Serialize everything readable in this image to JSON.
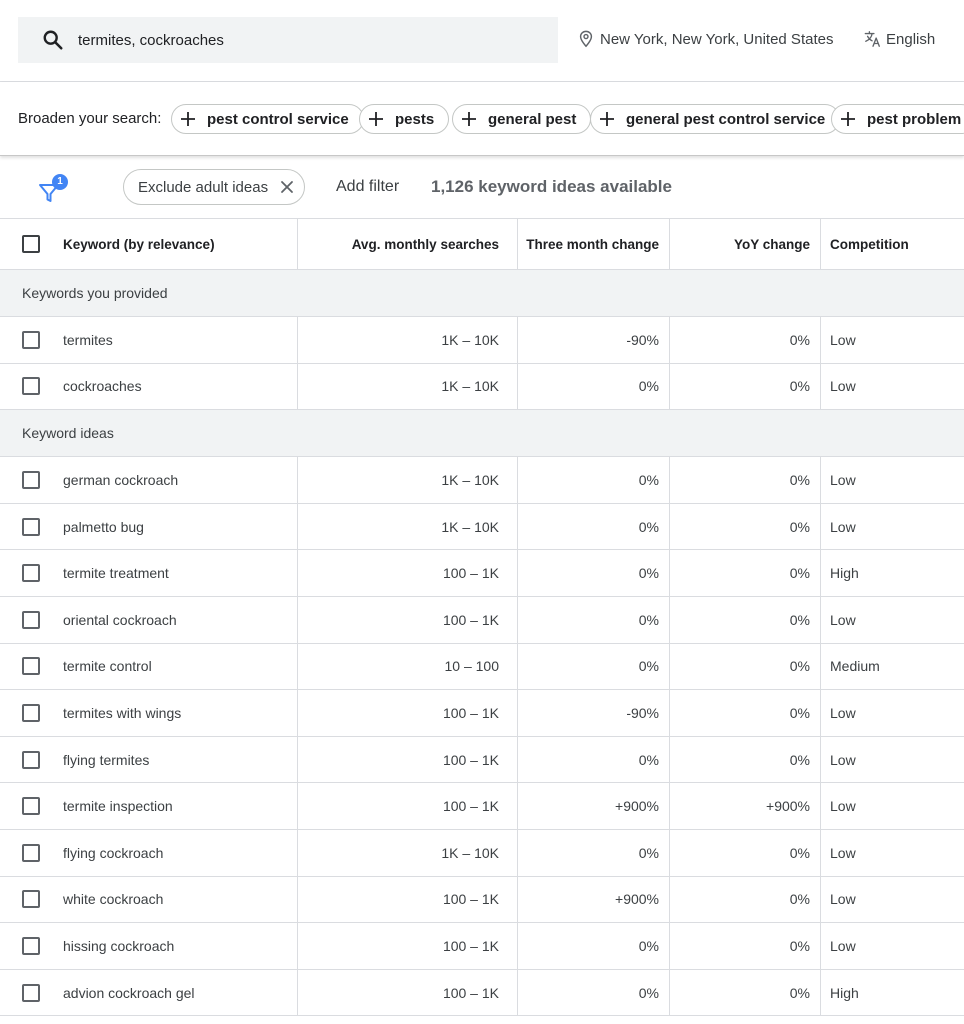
{
  "search": {
    "query": "termites, cockroaches",
    "location": "New York, New York, United States",
    "language": "English"
  },
  "broaden": {
    "label": "Broaden your search:",
    "chips": [
      "pest control service",
      "pests",
      "general pest",
      "general pest control service",
      "pest problem"
    ]
  },
  "filters": {
    "badge_count": "1",
    "exclude_chip": "Exclude adult ideas",
    "add_filter": "Add filter",
    "ideas_count": "1,126 keyword ideas available"
  },
  "table": {
    "headers": {
      "keyword": "Keyword (by relevance)",
      "avg": "Avg. monthly searches",
      "three_month": "Three month change",
      "yoy": "YoY change",
      "competition": "Competition"
    },
    "provided_label": "Keywords you provided",
    "provided": [
      {
        "keyword": "termites",
        "avg": "1K – 10K",
        "three_month": "-90%",
        "yoy": "0%",
        "competition": "Low"
      },
      {
        "keyword": "cockroaches",
        "avg": "1K – 10K",
        "three_month": "0%",
        "yoy": "0%",
        "competition": "Low"
      }
    ],
    "ideas_label": "Keyword ideas",
    "ideas": [
      {
        "keyword": "german cockroach",
        "avg": "1K – 10K",
        "three_month": "0%",
        "yoy": "0%",
        "competition": "Low"
      },
      {
        "keyword": "palmetto bug",
        "avg": "1K – 10K",
        "three_month": "0%",
        "yoy": "0%",
        "competition": "Low"
      },
      {
        "keyword": "termite treatment",
        "avg": "100 – 1K",
        "three_month": "0%",
        "yoy": "0%",
        "competition": "High"
      },
      {
        "keyword": "oriental cockroach",
        "avg": "100 – 1K",
        "three_month": "0%",
        "yoy": "0%",
        "competition": "Low"
      },
      {
        "keyword": "termite control",
        "avg": "10 – 100",
        "three_month": "0%",
        "yoy": "0%",
        "competition": "Medium"
      },
      {
        "keyword": "termites with wings",
        "avg": "100 – 1K",
        "three_month": "-90%",
        "yoy": "0%",
        "competition": "Low"
      },
      {
        "keyword": "flying termites",
        "avg": "100 – 1K",
        "three_month": "0%",
        "yoy": "0%",
        "competition": "Low"
      },
      {
        "keyword": "termite inspection",
        "avg": "100 – 1K",
        "three_month": "+900%",
        "yoy": "+900%",
        "competition": "Low"
      },
      {
        "keyword": "flying cockroach",
        "avg": "1K – 10K",
        "three_month": "0%",
        "yoy": "0%",
        "competition": "Low"
      },
      {
        "keyword": "white cockroach",
        "avg": "100 – 1K",
        "three_month": "+900%",
        "yoy": "0%",
        "competition": "Low"
      },
      {
        "keyword": "hissing cockroach",
        "avg": "100 – 1K",
        "three_month": "0%",
        "yoy": "0%",
        "competition": "Low"
      },
      {
        "keyword": "advion cockroach gel",
        "avg": "100 – 1K",
        "three_month": "0%",
        "yoy": "0%",
        "competition": "High"
      }
    ]
  },
  "colors": {
    "accent_blue": "#4285f4",
    "group_bg": "#f1f3f4",
    "border": "#dadce0"
  },
  "icons": [
    "search-icon",
    "location-pin-icon",
    "translate-icon",
    "plus-icon",
    "filter-funnel-icon",
    "close-icon"
  ]
}
